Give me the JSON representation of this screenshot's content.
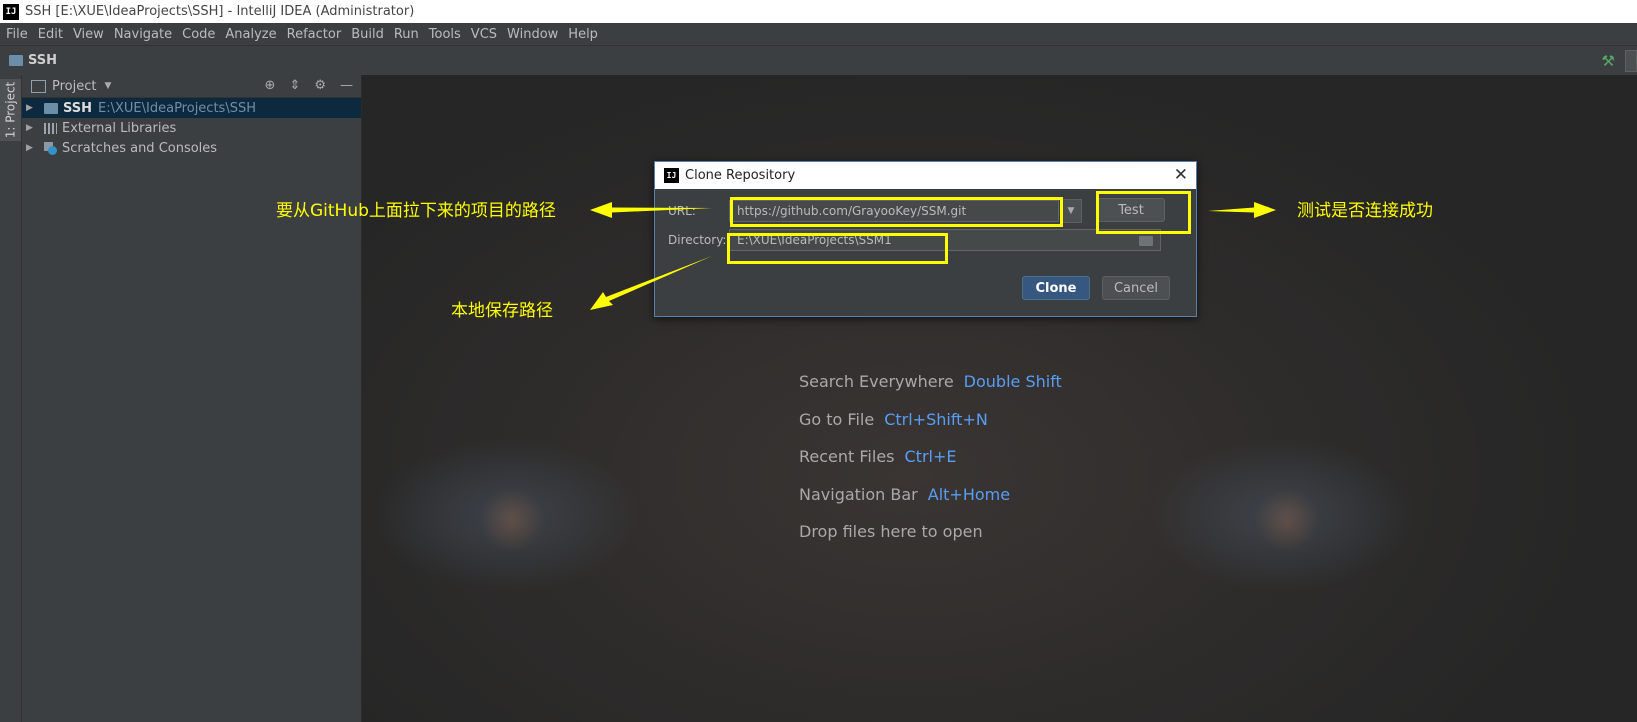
{
  "window": {
    "title": "SSH [E:\\XUE\\IdeaProjects\\SSH] - IntelliJ IDEA (Administrator)",
    "app_icon": "IJ"
  },
  "menu": [
    "File",
    "Edit",
    "View",
    "Navigate",
    "Code",
    "Analyze",
    "Refactor",
    "Build",
    "Run",
    "Tools",
    "VCS",
    "Window",
    "Help"
  ],
  "navbar": {
    "crumb": "SSH"
  },
  "tool_window": {
    "side_tab": "1: Project",
    "title": "Project",
    "tree": [
      {
        "label": "SSH",
        "path": "E:\\XUE\\IdeaProjects\\SSH",
        "icon": "folder-icon"
      },
      {
        "label": "External Libraries",
        "icon": "library-icon"
      },
      {
        "label": "Scratches and Consoles",
        "icon": "scratches-icon"
      }
    ]
  },
  "editor_hints": [
    {
      "text": "Search Everywhere",
      "key": "Double Shift"
    },
    {
      "text": "Go to File",
      "key": "Ctrl+Shift+N"
    },
    {
      "text": "Recent Files",
      "key": "Ctrl+E"
    },
    {
      "text": "Navigation Bar",
      "key": "Alt+Home"
    },
    {
      "text": "Drop files here to open",
      "key": ""
    }
  ],
  "dialog": {
    "title": "Clone Repository",
    "url_label": "URL:",
    "url_value": "https://github.com/GrayooKey/SSM.git",
    "test_label": "Test",
    "directory_label": "Directory:",
    "directory_value": "E:\\XUE\\IdeaProjects\\SSM1",
    "clone_label": "Clone",
    "cancel_label": "Cancel"
  },
  "annotations": {
    "url_note": "要从GitHub上面拉下来的项目的路径",
    "test_note": "测试是否连接成功",
    "dir_note": "本地保存路径",
    "color": "#ffff00"
  }
}
